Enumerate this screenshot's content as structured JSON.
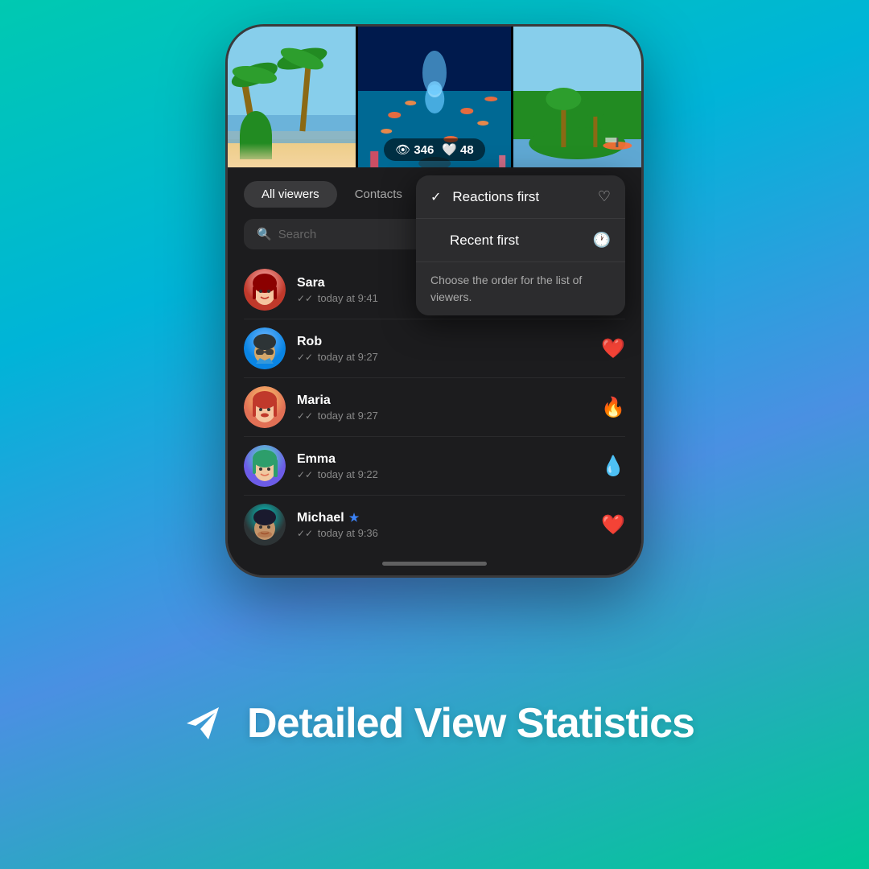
{
  "background": {
    "gradient_start": "#2dd4bf",
    "gradient_end": "#10b981"
  },
  "media": {
    "view_count": "346",
    "like_count": "48"
  },
  "tabs": {
    "all_viewers_label": "All viewers",
    "contacts_label": "Contacts"
  },
  "filter": {
    "icon": "♡",
    "chevron": "⌄"
  },
  "search": {
    "placeholder": "Search"
  },
  "viewers": [
    {
      "name": "Sara",
      "time": "today at 9:41",
      "reaction": ""
    },
    {
      "name": "Rob",
      "time": "today at 9:27",
      "reaction": "❤️"
    },
    {
      "name": "Maria",
      "time": "today at 9:27",
      "reaction": "🔥"
    },
    {
      "name": "Emma",
      "time": "today at 9:22",
      "reaction": "💧"
    },
    {
      "name": "Michael",
      "time": "today at 9:36",
      "reaction": "❤️",
      "badge": "★"
    }
  ],
  "dropdown": {
    "reactions_first_label": "Reactions first",
    "reactions_first_checked": true,
    "recent_first_label": "Recent first",
    "tooltip_text": "Choose the order for the list of viewers."
  },
  "footer": {
    "title": "Detailed View Statistics"
  }
}
